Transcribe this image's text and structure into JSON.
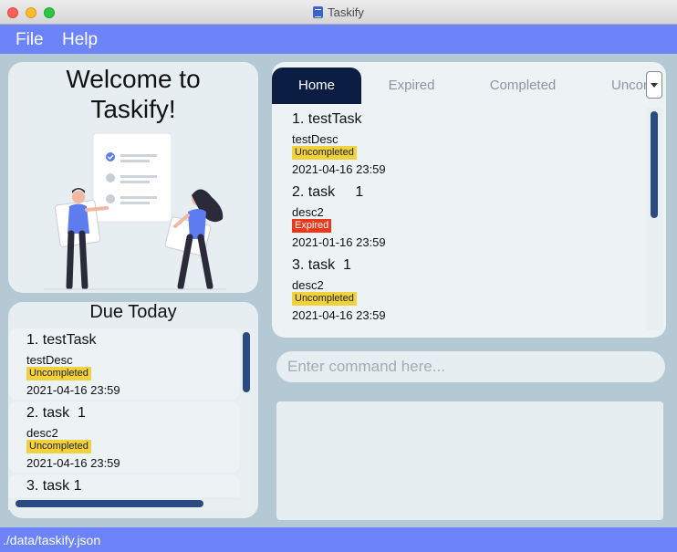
{
  "window": {
    "title": "Taskify"
  },
  "menu": {
    "file": "File",
    "help": "Help"
  },
  "welcome": {
    "title_line1": "Welcome to",
    "title_line2": "Taskify!"
  },
  "due_today": {
    "title": "Due Today",
    "tasks": [
      {
        "name": "1. testTask",
        "desc": "testDesc",
        "status": "Uncompleted",
        "date": "2021-04-16 23:59"
      },
      {
        "name": "2. task  1",
        "desc": "desc2",
        "status": "Uncompleted",
        "date": "2021-04-16 23:59"
      },
      {
        "name": "3. task 1",
        "desc": "",
        "status": "",
        "date": ""
      }
    ]
  },
  "tabs": {
    "home": "Home",
    "expired": "Expired",
    "completed": "Completed",
    "uncompleted": "Uncompleted"
  },
  "main_list": {
    "tasks": [
      {
        "name": "1. testTask",
        "desc": "testDesc",
        "status": "Uncompleted",
        "date": "2021-04-16 23:59"
      },
      {
        "name": "2. task     1",
        "desc": "desc2",
        "status": "Expired",
        "date": "2021-01-16 23:59"
      },
      {
        "name": "3. task  1",
        "desc": "desc2",
        "status": "Uncompleted",
        "date": "2021-04-16 23:59"
      }
    ]
  },
  "command": {
    "placeholder": "Enter command here..."
  },
  "status_bar": {
    "path": "./data/taskify.json"
  },
  "colors": {
    "accent": "#6c83fa",
    "tab_active": "#0c1d44",
    "badge_uncompleted": "#f2d23c",
    "badge_expired": "#e8391c",
    "scroll_thumb": "#2a4b82"
  },
  "icons": {
    "illustration": "two-people-checklist-illustration",
    "app": "clipboard-icon"
  }
}
